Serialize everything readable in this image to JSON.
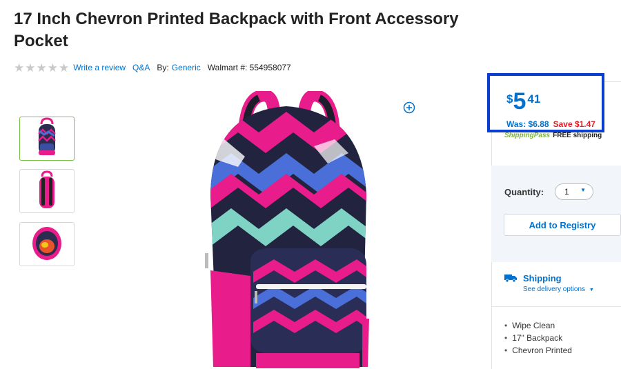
{
  "product": {
    "title": "17 Inch Chevron Printed Backpack with Front Accessory Pocket",
    "rating_stars": 5,
    "write_review": "Write a review",
    "qa": "Q&A",
    "by_label": "By:",
    "brand": "Generic",
    "item_label": "Walmart #: 554958077"
  },
  "price": {
    "currency": "$",
    "dollars": "5",
    "cents": "41",
    "was": "Was: $6.88",
    "save": "Save $1.47",
    "shipping_pass": "ShippingPass",
    "free_shipping": "FREE shipping"
  },
  "purchase": {
    "quantity_label": "Quantity:",
    "quantity_value": "1",
    "registry_button": "Add to Registry"
  },
  "shipping": {
    "title": "Shipping",
    "options_link": "See delivery options"
  },
  "features": [
    "Wipe Clean",
    "17\" Backpack",
    "Chevron Printed"
  ],
  "colors": {
    "link": "#0071ce",
    "save": "#de1c24",
    "highlight_border": "#0a3ecf",
    "pink": "#e81c8a",
    "shipping_pass": "#7cb342"
  },
  "icons": [
    "star-icon",
    "zoom-plus-icon",
    "truck-icon",
    "chevron-down-icon"
  ]
}
